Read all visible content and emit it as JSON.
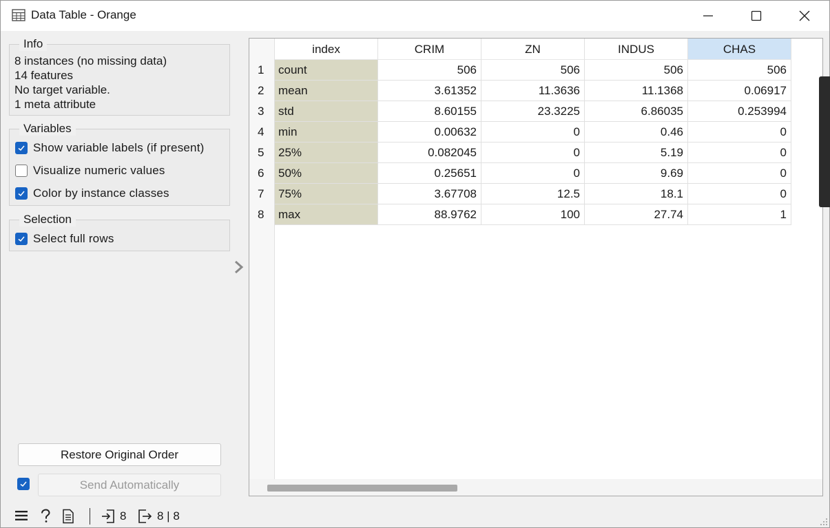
{
  "window": {
    "title": "Data Table - Orange",
    "controls": [
      "minimize-icon",
      "maximize-icon",
      "close-icon"
    ]
  },
  "info": {
    "title": "Info",
    "lines": [
      "8 instances (no missing data)",
      "14  features",
      "No target variable.",
      "1 meta attribute"
    ]
  },
  "variables": {
    "title": "Variables",
    "options": [
      {
        "label": "Show variable labels (if present)",
        "checked": true
      },
      {
        "label": "Visualize numeric values",
        "checked": false
      },
      {
        "label": "Color by instance classes",
        "checked": true
      }
    ]
  },
  "selection": {
    "title": "Selection",
    "options": [
      {
        "label": "Select full rows",
        "checked": true
      }
    ]
  },
  "buttons": {
    "restore": "Restore Original Order",
    "send": "Send Automatically",
    "send_auto_checked": true
  },
  "statusbar": {
    "input_count": "8",
    "output_count": "8 | 8"
  },
  "table": {
    "columns": [
      "index",
      "CRIM",
      "ZN",
      "INDUS",
      "CHAS"
    ],
    "selected_column": "CHAS",
    "rows": [
      {
        "num": "1",
        "cells": [
          "count",
          "506",
          "506",
          "506",
          "506"
        ]
      },
      {
        "num": "2",
        "cells": [
          "mean",
          "3.61352",
          "11.3636",
          "11.1368",
          "0.06917"
        ]
      },
      {
        "num": "3",
        "cells": [
          "std",
          "8.60155",
          "23.3225",
          "6.86035",
          "0.253994"
        ]
      },
      {
        "num": "4",
        "cells": [
          "min",
          "0.00632",
          "0",
          "0.46",
          "0"
        ]
      },
      {
        "num": "5",
        "cells": [
          "25%",
          "0.082045",
          "0",
          "5.19",
          "0"
        ]
      },
      {
        "num": "6",
        "cells": [
          "50%",
          "0.25651",
          "0",
          "9.69",
          "0"
        ]
      },
      {
        "num": "7",
        "cells": [
          "75%",
          "3.67708",
          "12.5",
          "18.1",
          "0"
        ]
      },
      {
        "num": "8",
        "cells": [
          "max",
          "88.9762",
          "100",
          "27.74",
          "1"
        ]
      }
    ]
  },
  "colors": {
    "meta_column_bg": "#d9d8c3",
    "selected_header_bg": "#cfe3f6",
    "checkbox_blue": "#1763c4"
  }
}
